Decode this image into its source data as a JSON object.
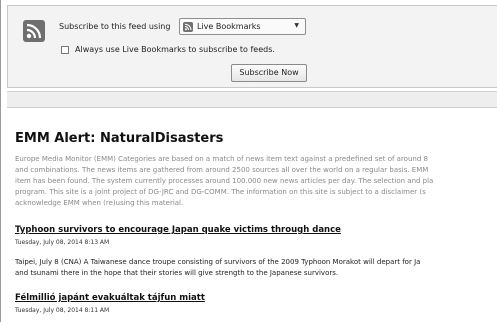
{
  "subscription": {
    "label": "Subscribe to this feed using",
    "reader_selected": "Live Bookmarks",
    "reader_icon": "live-bookmarks-icon",
    "checkbox_label": "Always use Live Bookmarks to subscribe to feeds.",
    "checkbox_checked": false,
    "button_label": "Subscribe Now"
  },
  "feed": {
    "title": "EMM Alert: NaturalDisasters",
    "description_lines": [
      "Europe Media Monitor (EMM) Categories are based on a match of news item text against a predefined set of around 8",
      "and combinations. The news items are gathered from around 2500 sources all over the world on a regular basis. EMM",
      "item has been found. The system currently processes around 100.000 new news articles per day. The selection and pla",
      "program. This site is a joint project of DG-JRC and DG-COMM. The information on this site is subject to a disclaimer (s",
      "acknowledge EMM when (re)using this material."
    ]
  },
  "items": [
    {
      "title": "Typhoon survivors to encourage Japan quake victims through dance",
      "date": "Tuesday, July 08, 2014 8:13 AM",
      "description_lines": [
        "Taipei, July 8 (CNA) A Taiwanese dance troupe consisting of survivors of the 2009 Typhoon Morakot will depart for Ja",
        "and tsunami there in the hope that their stories will give strength to the Japanese survivors."
      ]
    },
    {
      "title": "Félmillió japánt evakuáltak tájfun miatt",
      "date": "Tuesday, July 08, 2014 8:11 AM"
    }
  ]
}
